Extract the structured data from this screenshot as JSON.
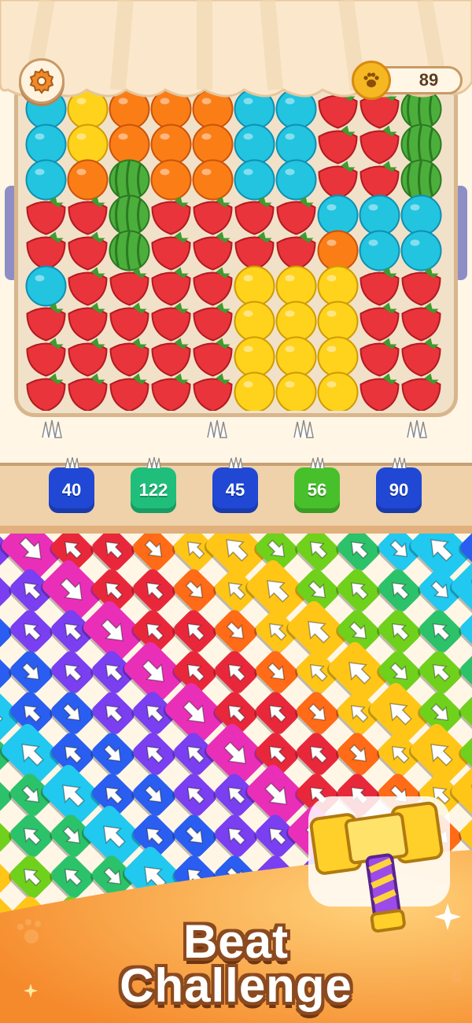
{
  "game": {
    "settings_icon": "gear-icon",
    "coins": {
      "icon": "paw-coin-icon",
      "value": "89"
    }
  },
  "board": {
    "fruit_types": [
      "strawberry",
      "orange",
      "lemon",
      "watermelon",
      "blueberry"
    ],
    "colors": {
      "strawberry": "#e8343a",
      "orange": "#fb7d16",
      "lemon": "#ffd21c",
      "watermelon": "#4caf3c",
      "blueberry": "#22c4e0"
    },
    "grid": [
      "BLOOOBBSSW",
      "BLOOOBBSSW",
      "BOWOOBBSSW",
      "SSWSSSSBBB",
      "SSWSSSSOBB",
      "BSSSSLLLSS",
      "SSSSSLLLSS",
      "SSSSSLLLSS",
      "SSSSSLLLSS"
    ]
  },
  "crates": [
    {
      "value": "40",
      "color": "#2048d4"
    },
    {
      "value": "122",
      "color": "#1fbe7a"
    },
    {
      "value": "45",
      "color": "#2048d4"
    },
    {
      "value": "56",
      "color": "#47c02c"
    },
    {
      "value": "90",
      "color": "#2048d4"
    }
  ],
  "arrow_palette": [
    "#21c8ef",
    "#2a5ef0",
    "#7a3ff0",
    "#e92fb8",
    "#e8283a",
    "#ff6b16",
    "#ffc617",
    "#6fd11c",
    "#2cc26a"
  ],
  "banner": {
    "line1": "Beat",
    "line2": "Challenge",
    "booster_icon": "hammer-icon"
  }
}
